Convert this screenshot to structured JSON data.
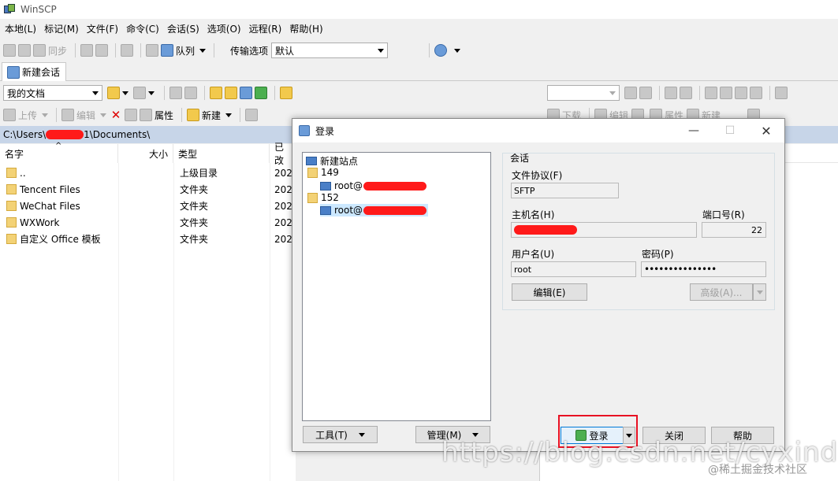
{
  "window": {
    "title": "WinSCP"
  },
  "menu": [
    "本地(L)",
    "标记(M)",
    "文件(F)",
    "命令(C)",
    "会话(S)",
    "选项(O)",
    "远程(R)",
    "帮助(H)"
  ],
  "toolbar1": {
    "sync": "同步",
    "queue": "队列",
    "transfer_label": "传输选项",
    "transfer_value": "默认"
  },
  "tabs": {
    "new_session": "新建会话"
  },
  "local_toolbar": {
    "location": "我的文档",
    "upload": "上传",
    "edit": "编辑",
    "props": "属性",
    "new": "新建"
  },
  "remote_toolbar": {
    "download": "下载",
    "edit": "编辑",
    "props": "属性",
    "new": "新建"
  },
  "path": {
    "prefix": "C:\\Users\\",
    "suffix": "1\\Documents\\"
  },
  "columns": {
    "name": "名字",
    "size": "大小",
    "type": "类型",
    "changed": "已改"
  },
  "files": [
    {
      "name": "..",
      "type": "上级目录",
      "date": "2020"
    },
    {
      "name": "Tencent Files",
      "type": "文件夹",
      "date": "2020"
    },
    {
      "name": "WeChat Files",
      "type": "文件夹",
      "date": "2020"
    },
    {
      "name": "WXWork",
      "type": "文件夹",
      "date": "2020"
    },
    {
      "name": "自定义 Office 模板",
      "type": "文件夹",
      "date": "2020"
    }
  ],
  "dialog": {
    "title": "登录",
    "tree": {
      "new_site": "新建站点",
      "folder1": "149",
      "host1": "root@",
      "folder2": "152",
      "host2": "root@"
    },
    "session_group": "会话",
    "protocol_label": "文件协议(F)",
    "protocol_value": "SFTP",
    "host_label": "主机名(H)",
    "port_label": "端口号(R)",
    "port_value": "22",
    "user_label": "用户名(U)",
    "user_value": "root",
    "password_label": "密码(P)",
    "password_value": "•••••••••••••••",
    "edit_btn": "编辑(E)",
    "advanced_btn": "高级(A)...",
    "tools_btn": "工具(T)",
    "manage_btn": "管理(M)",
    "login_btn": "登录",
    "close_btn": "关闭",
    "help_btn": "帮助"
  },
  "watermark": {
    "url": "https://blog.csdn.net/cyxinda",
    "site": "@稀土掘金技术社区"
  },
  "colors": {
    "accent": "#0078d7",
    "highlight": "#e81123",
    "path_bar": "#c7d5e8"
  }
}
